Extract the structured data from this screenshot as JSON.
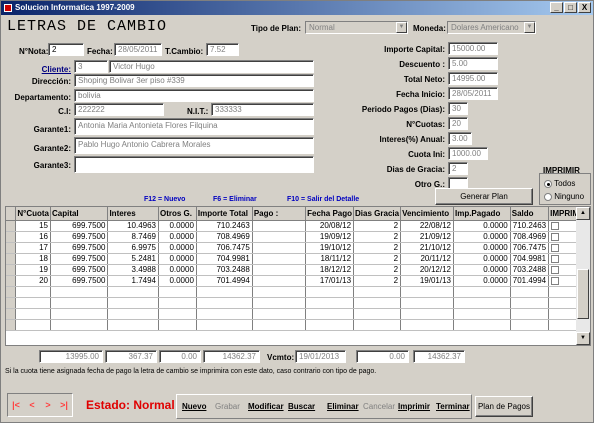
{
  "window": {
    "title": "Solucion Informatica 1997-2009",
    "buttons": [
      "_",
      "□",
      "X"
    ]
  },
  "heading": "LETRAS DE CAMBIO",
  "tipo_plan": {
    "label": "Tipo de Plan:",
    "value": "Normal"
  },
  "moneda": {
    "label": "Moneda:",
    "value": "Dolares Americano"
  },
  "left": {
    "nnota_label": "N°Nota:",
    "nnota": "2",
    "fecha_label": "Fecha:",
    "fecha": "28/05/2011",
    "tcambio_label": "T.Cambio:",
    "tcambio": "7.52",
    "cliente_label": "Cliente:",
    "cliente_id": "3",
    "cliente_nombre": "Victor Hugo",
    "direccion_label": "Dirección:",
    "direccion": "Shoping Bolivar 3er piso #339",
    "departamento_label": "Departamento:",
    "departamento": "bolivia",
    "ci_label": "C.I:",
    "ci": "222222",
    "nit_label": "N.I.T.:",
    "nit": "333333",
    "garante1_label": "Garante1:",
    "garante1": "Antonia Maria Antonieta Flores Filquina",
    "garante2_label": "Garante2:",
    "garante2": "Pablo Hugo Antonio Cabrera Morales",
    "garante3_label": "Garante3:",
    "garante3": ""
  },
  "right": {
    "importe_label": "Importe Capital:",
    "importe": "15000.00",
    "descuento_label": "Descuento :",
    "descuento": "5.00",
    "total_label": "Total Neto:",
    "total": "14995.00",
    "fecha_inicio_label": "Fecha Inicio:",
    "fecha_inicio": "28/05/2011",
    "periodo_label": "Periodo Pagos (Dias):",
    "periodo": "30",
    "ncuotas_label": "N°Cuotas:",
    "ncuotas": "20",
    "interes_label": "Interes(%) Anual:",
    "interes": "3.00",
    "cuota_ini_label": "Cuota Ini:",
    "cuota_ini": "1000.00",
    "dias_gracia_label": "Dias de Gracia:",
    "dias_gracia": "2",
    "otro_label": "Otro G.:",
    "otro": ""
  },
  "generar_plan": "Generar Plan",
  "imprimir": {
    "title": "IMPRIMIR",
    "todos": "Todos",
    "ninguno": "Ninguno"
  },
  "hints": {
    "f12": "F12 = Nuevo",
    "f6": "F6 = Eliminar",
    "f10": "F10 = Salir del Detalle"
  },
  "table": {
    "headers": [
      "N°Cuota",
      "Capital",
      "Interes",
      "Otros G.",
      "Importe Total",
      "Pago :",
      "Fecha Pago",
      "Dias Gracia",
      "Vencimiento",
      "Imp.Pagado",
      "Saldo",
      "IMPRIMI"
    ],
    "rows": [
      [
        "15",
        "699.7500",
        "10.4963",
        "0.0000",
        "710.2463",
        "",
        "20/08/12",
        "2",
        "22/08/12",
        "0.0000",
        "710.2463"
      ],
      [
        "16",
        "699.7500",
        "8.7469",
        "0.0000",
        "708.4969",
        "",
        "19/09/12",
        "2",
        "21/09/12",
        "0.0000",
        "708.4969"
      ],
      [
        "17",
        "699.7500",
        "6.9975",
        "0.0000",
        "706.7475",
        "",
        "19/10/12",
        "2",
        "21/10/12",
        "0.0000",
        "706.7475"
      ],
      [
        "18",
        "699.7500",
        "5.2481",
        "0.0000",
        "704.9981",
        "",
        "18/11/12",
        "2",
        "20/11/12",
        "0.0000",
        "704.9981"
      ],
      [
        "19",
        "699.7500",
        "3.4988",
        "0.0000",
        "703.2488",
        "",
        "18/12/12",
        "2",
        "20/12/12",
        "0.0000",
        "703.2488"
      ],
      [
        "20",
        "699.7500",
        "1.7494",
        "0.0000",
        "701.4994",
        "",
        "17/01/13",
        "2",
        "19/01/13",
        "0.0000",
        "701.4994"
      ]
    ]
  },
  "totals": {
    "t1": "13995.00",
    "t2": "367.37",
    "t3": "0.00",
    "t4": "14362.37",
    "vcmto_label": "Vcmto:",
    "vcmto": "19/01/2013",
    "t5": "0.00",
    "t6": "14362.37"
  },
  "note": "Si la cuota tiene asignada fecha de pago la letra de cambio se imprimira con este dato, caso contrario con tipo de pago.",
  "nav": [
    "|<",
    "<",
    ">",
    ">|"
  ],
  "estado": "Estado: Normal",
  "toolbar": [
    "Nuevo",
    "Grabar",
    "Modificar",
    "Buscar",
    "Eliminar",
    "Cancelar",
    "Imprimir",
    "Terminar"
  ],
  "plan_pagos": "Plan de Pagos"
}
